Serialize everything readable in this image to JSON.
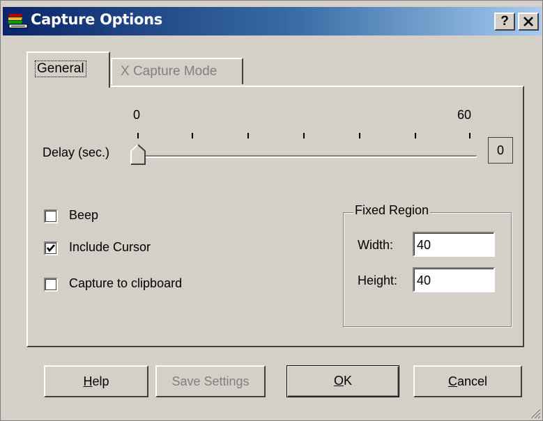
{
  "window": {
    "title": "Capture Options",
    "title_icon": "stacked-books-icon",
    "help_glyph": "?",
    "close_glyph": "✕",
    "titlebar_color": "#0a246a"
  },
  "tabs": [
    {
      "label": "General",
      "active": true
    },
    {
      "label": "X Capture Mode",
      "active": false,
      "disabled": true
    }
  ],
  "delay": {
    "label": "Delay (sec.)",
    "min_label": "0",
    "max_label": "60",
    "value": "0",
    "min": 0,
    "max": 60
  },
  "checkboxes": [
    {
      "label": "Beep",
      "checked": false
    },
    {
      "label": "Include Cursor",
      "checked": true
    },
    {
      "label": "Capture to clipboard",
      "checked": false
    }
  ],
  "fixed_region": {
    "title": "Fixed Region",
    "width_label": "Width:",
    "width_value": "40",
    "height_label": "Height:",
    "height_value": "40"
  },
  "buttons": {
    "help": {
      "accel": "H",
      "rest": "elp"
    },
    "save": {
      "label": "Save Settings",
      "disabled": true
    },
    "ok": {
      "accel": "O",
      "rest": "K"
    },
    "cancel": {
      "accel": "C",
      "rest": "ancel"
    }
  }
}
